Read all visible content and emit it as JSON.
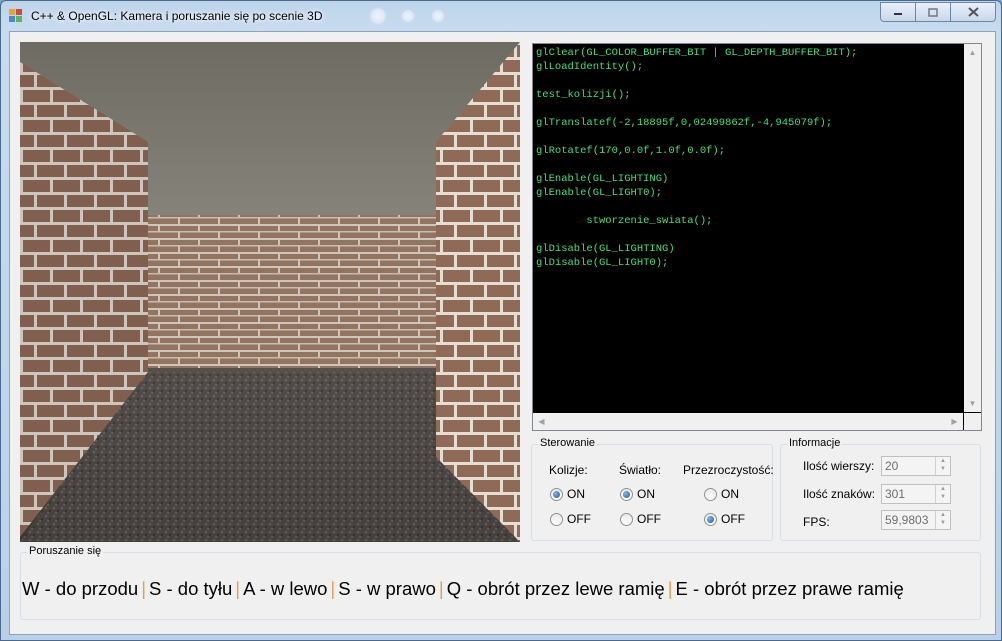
{
  "window": {
    "title": "C++ & OpenGL: Kamera i poruszanie się po scenie 3D"
  },
  "scene": {
    "description_icon": "opengl-maze-render"
  },
  "code": {
    "lines": [
      "glClear(GL_COLOR_BUFFER_BIT | GL_DEPTH_BUFFER_BIT);",
      "glLoadIdentity();",
      "",
      "test_kolizji();",
      "",
      "glTranslatef(-2,18895f,0,02499862f,-4,945079f);",
      "",
      "glRotatef(170,0.0f,1.0f,0.0f);",
      "",
      "glEnable(GL_LIGHTING)",
      "glEnable(GL_LIGHT0);",
      "",
      "        stworzenie_swiata();",
      "",
      "glDisable(GL_LIGHTING)",
      "glDisable(GL_LIGHT0);"
    ],
    "text_color": "#3ee07a"
  },
  "sterowanie": {
    "title": "Sterowanie",
    "kolizje": {
      "label": "Kolizje:",
      "on": "ON",
      "off": "OFF",
      "selected": "ON"
    },
    "swiatlo": {
      "label": "Światło:",
      "on": "ON",
      "off": "OFF",
      "selected": "ON"
    },
    "przezroczystosc": {
      "label": "Przezroczystość:",
      "on": "ON",
      "off": "OFF",
      "selected": "OFF"
    }
  },
  "informacje": {
    "title": "Informacje",
    "wiersze_label": "Ilość wierszy:",
    "wiersze_value": "20",
    "znaki_label": "Ilość znaków:",
    "znaki_value": "301",
    "fps_label": "FPS:",
    "fps_value": "59,9803"
  },
  "poruszanie": {
    "title": "Poruszanie się",
    "items": [
      "W - do przodu",
      "S - do tyłu",
      "A - w lewo",
      "S - w prawo",
      "Q - obrót przez lewe ramię",
      "E - obrót przez prawe ramię"
    ]
  }
}
